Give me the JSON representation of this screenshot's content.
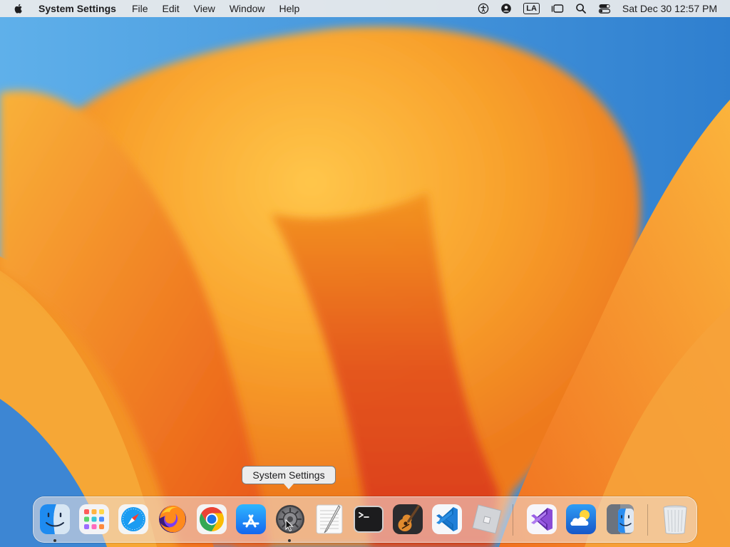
{
  "menubar": {
    "app_name": "System Settings",
    "menus": [
      "File",
      "Edit",
      "View",
      "Window",
      "Help"
    ],
    "status": {
      "input_source": "LA",
      "clock": "Sat Dec 30  12:57 PM"
    }
  },
  "dock": {
    "tooltip": "System Settings",
    "apps": [
      {
        "name": "Finder",
        "icon": "finder-icon",
        "running": true
      },
      {
        "name": "Launchpad",
        "icon": "launchpad-icon",
        "running": false
      },
      {
        "name": "Safari",
        "icon": "safari-icon",
        "running": false
      },
      {
        "name": "Firefox",
        "icon": "firefox-icon",
        "running": false
      },
      {
        "name": "Google Chrome",
        "icon": "chrome-icon",
        "running": false
      },
      {
        "name": "App Store",
        "icon": "app-store-icon",
        "running": false
      },
      {
        "name": "System Settings",
        "icon": "system-settings-icon",
        "running": true
      },
      {
        "name": "TextEdit",
        "icon": "textedit-icon",
        "running": false
      },
      {
        "name": "Terminal",
        "icon": "terminal-icon",
        "running": false
      },
      {
        "name": "GarageBand",
        "icon": "garageband-icon",
        "running": false
      },
      {
        "name": "Visual Studio Code",
        "icon": "vscode-icon",
        "running": false
      },
      {
        "name": "Roblox",
        "icon": "roblox-icon",
        "running": false
      },
      {
        "name": "Visual Studio",
        "icon": "visual-studio-icon",
        "running": false
      },
      {
        "name": "Weather",
        "icon": "weather-icon",
        "running": false
      },
      {
        "name": "Migration Assistant",
        "icon": "migration-assistant-icon",
        "running": false
      },
      {
        "name": "Trash",
        "icon": "trash-icon",
        "running": false
      }
    ]
  },
  "colors": {
    "menubar_bg": "#ececec",
    "wallpaper_orange": "#f39a2b",
    "wallpaper_blue": "#3a8fd9",
    "accent_blue": "#0a84ff"
  }
}
